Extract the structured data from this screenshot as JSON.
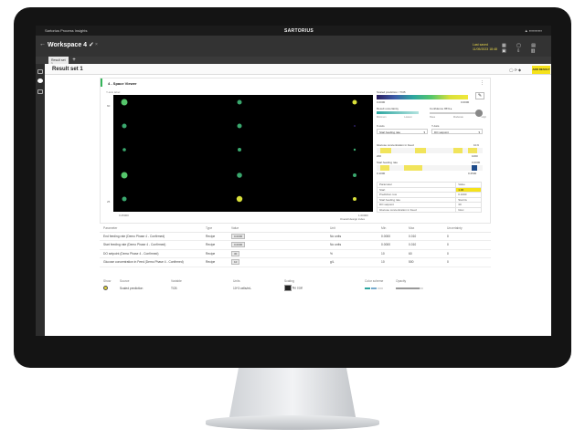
{
  "app": {
    "name": "Sartorius Process Insights",
    "brand": "SARTORIUS",
    "user": "▲ ▪▪▪▪▪▪▪▪▪▪"
  },
  "workspace": {
    "back": "←",
    "title": "Workspace 4 ✓",
    "close": "×",
    "date_line1": "Last saved",
    "date_line2": "11/05/2023 18:48"
  },
  "tabs": [
    {
      "label": "Result set 1"
    }
  ],
  "result": {
    "title": "Result set 1",
    "add_label": "ADD RESULT"
  },
  "panel": {
    "title": "4 - Space Viewer",
    "plot_label": "Y-axis label",
    "y_ticks": [
      "60",
      "25"
    ],
    "x_ticks": [
      "0.25000",
      "1.00000"
    ],
    "x_axis_label": "Overall design index",
    "color_label": "Scaled prediction / TCB",
    "color_min": "0.0000",
    "color_max": "0.0000",
    "uncert_label": "Result uncertainty",
    "confidence_label": "Confidence 95% ▸",
    "uncert_ticks": [
      "Minimum",
      "Lowest",
      "Base",
      "Moderate",
      "High"
    ],
    "xaxis_label": "X-Axis",
    "yaxis_label": "Y-Axis",
    "xaxis_value": "Start feeding rate",
    "yaxis_value": "DO setpoint",
    "slider1_label": "Glucose concentration in Feed",
    "slider1_value": "10.9",
    "slider2_label": "Start feeding rate",
    "slider2_value": "0.0000",
    "slider1_ticks": [
      "200",
      "1000"
    ],
    "slider2_ticks": [
      "0.1000",
      "0.2500"
    ],
    "prop_header": [
      "Parameter",
      "Value"
    ],
    "props": [
      [
        "Start",
        "1.00"
      ],
      [
        "Prediction row",
        "0.1000"
      ],
      [
        "Start feeding rate",
        "Start fe"
      ],
      [
        "DO setpoint",
        "30"
      ],
      [
        "Glucose concentration in Feed",
        "Gluc"
      ]
    ]
  },
  "params_table": {
    "headers": [
      "Parameter",
      "Type",
      "Value",
      "Unit",
      "Min",
      "Max",
      "Uncertainty"
    ],
    "rows": [
      [
        "End feeding rate (Demo Phase 4 - Confirmed)",
        "Recipe",
        "0.0000",
        "No units",
        "0.0000",
        "0.010",
        "0"
      ],
      [
        "Start feeding rate (Demo Phase 4 - Confirmed)",
        "Recipe",
        "0.0000",
        "No units",
        "0.0000",
        "0.010",
        "0"
      ],
      [
        "DO setpoint (Demo Phase 4 - Confirmed)",
        "Recipe",
        "30",
        "%",
        "10",
        "60",
        "0"
      ],
      [
        "Glucose concentration in Feed (Demo Phase 4 - Confirmed)",
        "Recipe",
        "10",
        "g/L",
        "10",
        "500",
        "0"
      ]
    ]
  },
  "factor_table": {
    "headers": [
      "Show",
      "Source",
      "Variable",
      "Units",
      "Scaling",
      "Color scheme",
      "Opacity"
    ],
    "rows": [
      [
        "",
        "Scaled prediction",
        "TCB",
        "10^3 cells/mL",
        "No scal",
        "",
        ""
      ]
    ]
  },
  "colors": {
    "accent": "#f5e21b",
    "panel_accent": "#34b55a"
  }
}
